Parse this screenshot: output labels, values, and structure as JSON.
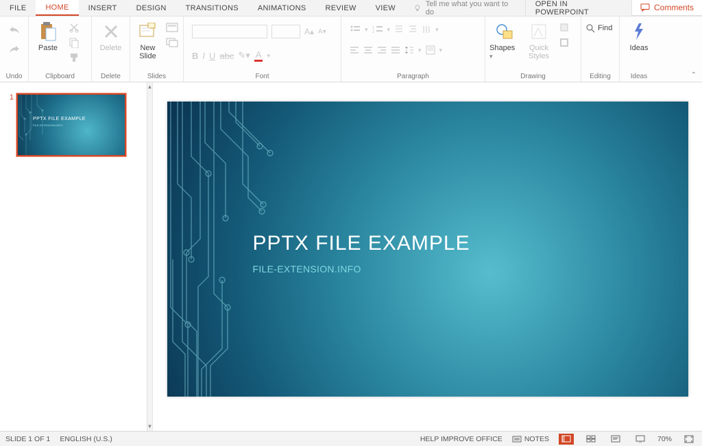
{
  "tabs": {
    "file": "FILE",
    "home": "HOME",
    "insert": "INSERT",
    "design": "DESIGN",
    "transitions": "TRANSITIONS",
    "animations": "ANIMATIONS",
    "review": "REVIEW",
    "view": "VIEW",
    "tell_me": "Tell me what you want to do",
    "open_pp": "OPEN IN POWERPOINT",
    "comments": "Comments"
  },
  "ribbon": {
    "undo_group": "Undo",
    "clipboard_group": "Clipboard",
    "delete_group": "Delete",
    "slides_group": "Slides",
    "font_group": "Font",
    "paragraph_group": "Paragraph",
    "drawing_group": "Drawing",
    "editing_group": "Editing",
    "ideas_group": "Ideas",
    "paste": "Paste",
    "delete": "Delete",
    "new_slide": "New\nSlide",
    "shapes": "Shapes",
    "quick_styles": "Quick\nStyles",
    "find": "Find",
    "ideas": "Ideas"
  },
  "thumbs": {
    "n1": "1"
  },
  "slide": {
    "title": "PPTX FILE EXAMPLE",
    "subtitle": "FILE-EXTENSION.INFO"
  },
  "status": {
    "slide_of": "SLIDE 1 OF 1",
    "lang": "ENGLISH (U.S.)",
    "help": "HELP IMPROVE OFFICE",
    "notes": "NOTES",
    "zoom": "70%"
  }
}
